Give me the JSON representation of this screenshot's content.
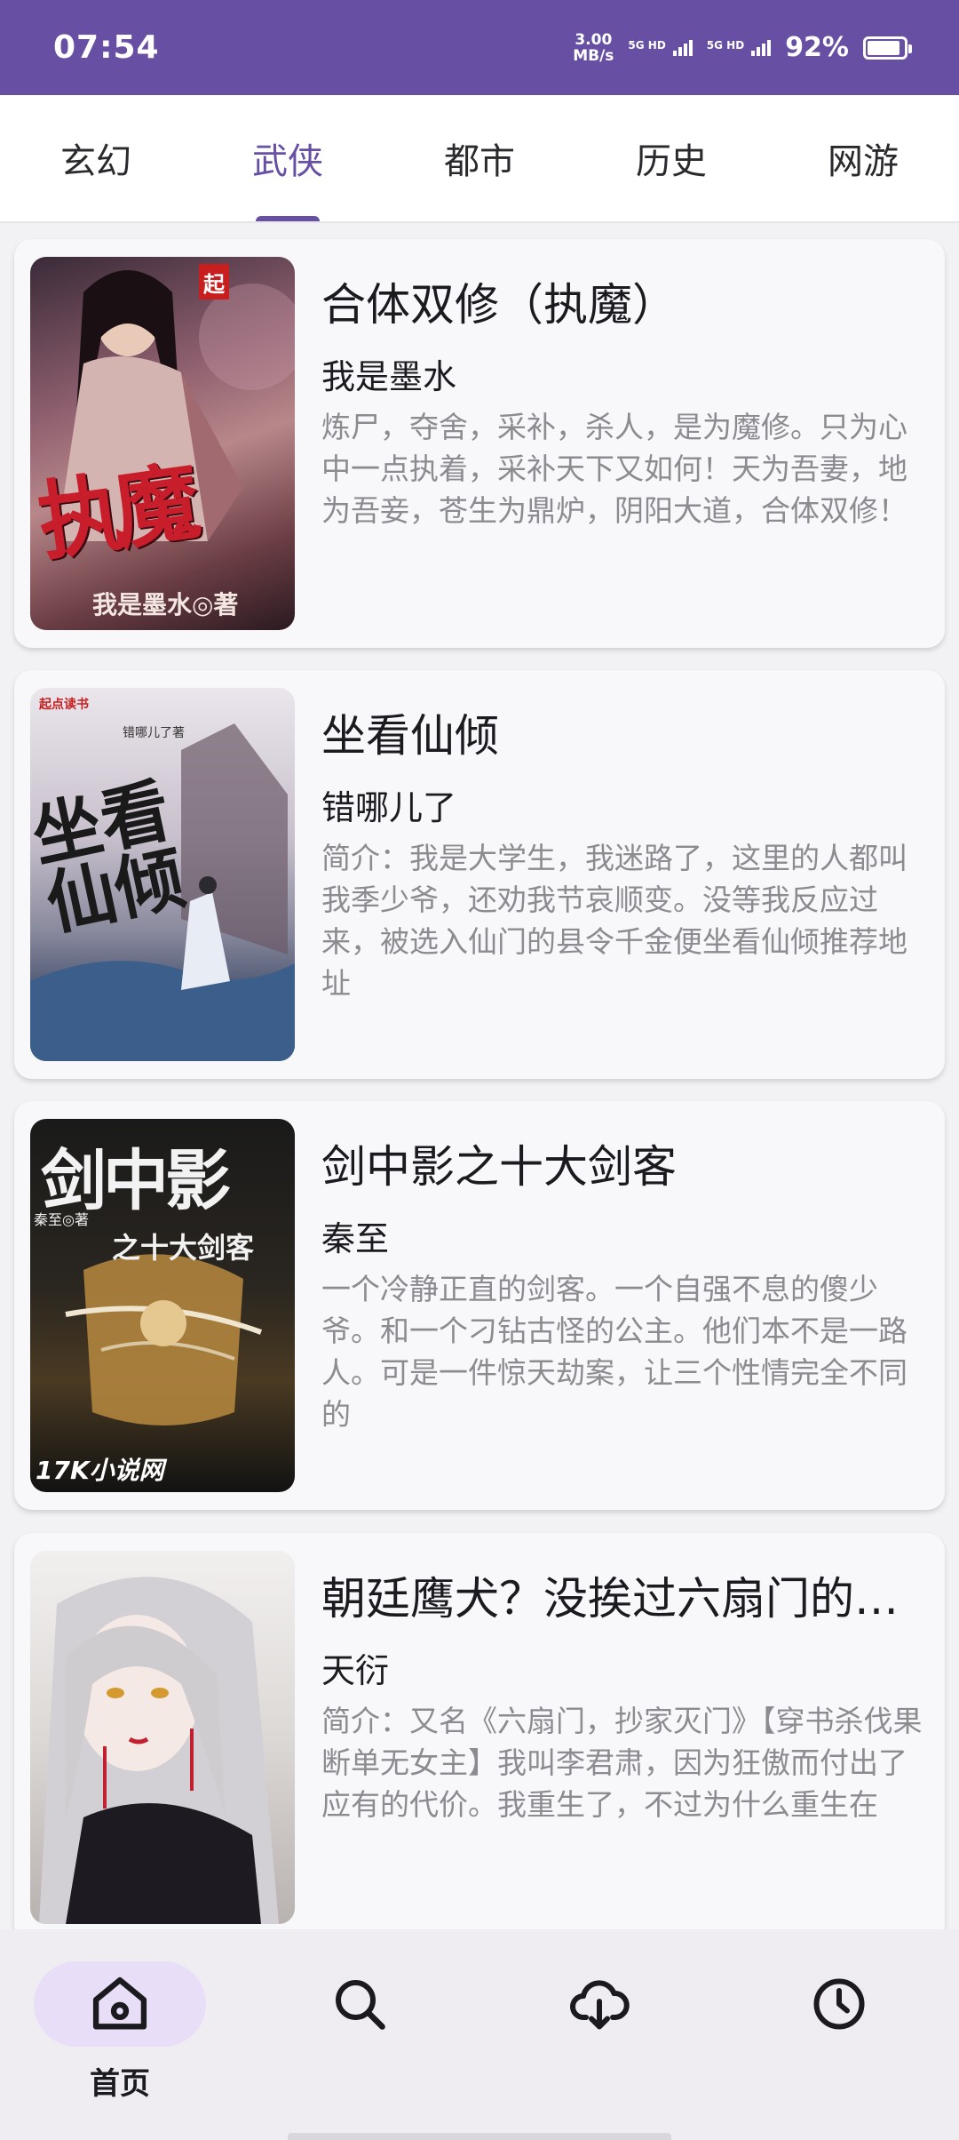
{
  "status_bar": {
    "time": "07:54",
    "net_speed_value": "3.00",
    "net_speed_unit": "MB/s",
    "sim1_label": "5G HD",
    "sim2_label": "5G HD",
    "battery_percent_text": "92%",
    "battery_level": 0.92
  },
  "tabs": [
    {
      "label": "玄幻",
      "active": false
    },
    {
      "label": "武侠",
      "active": true
    },
    {
      "label": "都市",
      "active": false
    },
    {
      "label": "历史",
      "active": false
    },
    {
      "label": "网游",
      "active": false
    }
  ],
  "books": [
    {
      "title": "合体双修（执魔）",
      "author": "我是墨水",
      "description": "炼尸，夺舍，采补，杀人，是为魔修。只为心中一点执着，采补天下又如何！天为吾妻，地为吾妾，苍生为鼎炉，阴阳大道，合体双修！",
      "cover_text": "执魔",
      "cover_badge": "起",
      "cover_author": "我是墨水◎著"
    },
    {
      "title": "坐看仙倾",
      "author": "错哪儿了",
      "description": "简介：我是大学生，我迷路了，这里的人都叫我季少爷，还劝我节哀顺变。没等我反应过来，被选入仙门的县令千金便坐看仙倾推荐地址",
      "cover_text": "坐看仙倾",
      "cover_badge": "起点读书",
      "cover_author": "错哪儿了著"
    },
    {
      "title": "剑中影之十大剑客",
      "author": "秦至",
      "description": "一个冷静正直的剑客。一个自强不息的傻少爷。和一个刁钻古怪的公主。他们本不是一路人。可是一件惊天劫案，让三个性情完全不同的",
      "cover_text": "剑中影",
      "cover_subtitle": "之十大剑客",
      "cover_badge": "17K小说网",
      "cover_author": "秦至◎著"
    },
    {
      "title": "朝廷鹰犬？没挨过六扇门的毒打吧",
      "author": "天衍",
      "description": "简介：又名《六扇门，抄家灭门》【穿书杀伐果断单无女主】我叫李君肃，因为狂傲而付出了应有的代价。我重生了，不过为什么重生在",
      "cover_text": "",
      "cover_badge": "",
      "cover_author": ""
    }
  ],
  "bottom_nav": [
    {
      "icon": "home-icon",
      "label": "首页",
      "active": true
    },
    {
      "icon": "search-icon",
      "label": "",
      "active": false
    },
    {
      "icon": "cloud-download-icon",
      "label": "",
      "active": false
    },
    {
      "icon": "clock-icon",
      "label": "",
      "active": false
    }
  ],
  "colors": {
    "primary": "#6750a4",
    "nav_active_pill": "#e8def8",
    "description_text": "#8c8c90"
  }
}
